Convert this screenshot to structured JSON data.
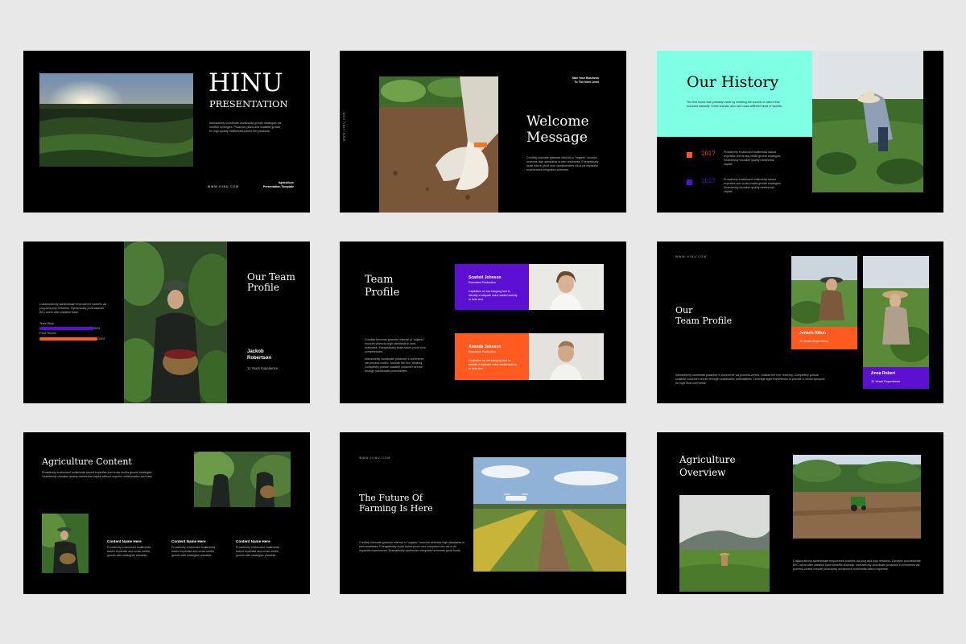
{
  "colors": {
    "accent_teal": "#7fffe3",
    "accent_orange": "#ff5a1f",
    "accent_purple": "#5a0fd1",
    "slide_bg": "#000000",
    "page_bg": "#e8e8e9"
  },
  "s1": {
    "title": "HINU",
    "subtitle": "PRESENTATION",
    "body": "Interactively coordinate multimedia growth strategies via intuitive synergies. Proactive plans and scalable growth for high-quality multimedia-based test products.",
    "url": "W W W . H I N U . C O M",
    "footer_line1": "Agriculture",
    "footer_line2": "Presentation Template"
  },
  "s2": {
    "top_line1": "Take Your Business",
    "top_line2": "To The Next Level",
    "vertical": "W W W . H I N U . C O M",
    "title_line1": "Welcome",
    "title_line2": "Message",
    "body": "Credibly innovate granular internal or \"organic\" sources whereas high standards in web-readiness. Energistically scale future-proof core competencies vis-a-vis impactful experiences integrated schemas."
  },
  "s3": {
    "title": "Our History",
    "intro": "The first music was probably made by imitating the sounds of nature that occurred naturally. Some animals also use music-different kinds of sounds.",
    "timeline": [
      {
        "year": "2017",
        "text": "Proactively envisioned multimedia based expertise and cross-media growth strategies. Seamlessly visualize quality intellectual capital."
      },
      {
        "year": "2027",
        "text": "Proactively envisioned multimedia based expertise and cross-media growth strategies. Seamlessly visualize quality intellectual capital."
      }
    ]
  },
  "s4": {
    "title_line1": "Our Team",
    "title_line2": "Profile",
    "body": "Collaboratively administrate empowered markets via plug-and-play networks. Dynamically procrastinate B2C users after installed base.",
    "skills": [
      {
        "label": "Team Work",
        "pct_text": "90%",
        "fraction": 0.9
      },
      {
        "label": "Food Techno",
        "pct_text": "100%",
        "fraction": 1.0
      }
    ],
    "name_line1": "Jackob",
    "name_line2": "Robertson",
    "experience": "11 Years Experience"
  },
  "s5": {
    "title_line1": "Team",
    "title_line2": "Profile",
    "body": "Credibly innovate granular internal or \"organic\" sources whereas high standards in web-readiness. Energistically scale future-proof core competencies.",
    "body2": "Interactively coordinate proactive e-commerce via process-centric \"outside the box\" thinking. Completely pursue scalable customer service through sustainable potentialities.",
    "cards": [
      {
        "name": "Scarlett Johnson",
        "role": "Executive Production",
        "text": "Capitalize on low hanging fruit to identify a ballpark value added activity to beta test."
      },
      {
        "name": "Ananda Johnson",
        "role": "Executive Production",
        "text": "Capitalize on low hanging fruit to identify a ballpark value added activity to beta test."
      }
    ]
  },
  "s6": {
    "url": "W W W . H I N U . C O M",
    "title_line1": "Our",
    "title_line2": "Team Profile",
    "body": "Interactively coordinate proactive e-commerce via process-centric \"outside the box\" thinking. Completely pursue scalable customer service through sustainable potentialities. Leverage agile frameworks to provide a robust synopsis for high level overviews.",
    "members": [
      {
        "name": "Jonash Hilton",
        "experience": "11 Years Experience"
      },
      {
        "name": "Anna Robert",
        "experience": "11 Years Experience"
      }
    ]
  },
  "s7": {
    "title": "Agriculture Content",
    "body": "Proactively envisioned multimedia based expertise and cross-media growth strategies. Seamlessly visualize quality intellectual capital without superior collaboration and idea.",
    "columns": [
      {
        "title": "Content Name Here",
        "text": "Proactively envisioned multimedia based expertise and cross-media growth with strategies visualize."
      },
      {
        "title": "Content Name Here",
        "text": "Proactively envisioned multimedia based expertise and cross-media growth with strategies visualize."
      },
      {
        "title": "Content Name Here",
        "text": "Proactively envisioned multimedia based expertise and cross-media growth with strategies visualize."
      }
    ]
  },
  "s8": {
    "url": "W W W . H I N U . C O M",
    "title_line1": "The Future Of",
    "title_line2": "Farming Is Here",
    "body": "Credibly innovate granular internal or \"organic\" sources whereas high standards in web-readiness. Energistically scale future-proof core competencies vis-a-vis impactful experiences. Dramatically synthesize integrated schemas good foods."
  },
  "s9": {
    "title_line1": "Agriculture",
    "title_line2": "Overview",
    "body": "Collaboratively administrate empowered markets via plug and play networks. Dynamic procrastinate B2C users after installed base benefits dramatic. Interactively coordinate proactive e-commerce via process-centric outside proactively envisioned multimedia based expertise."
  }
}
